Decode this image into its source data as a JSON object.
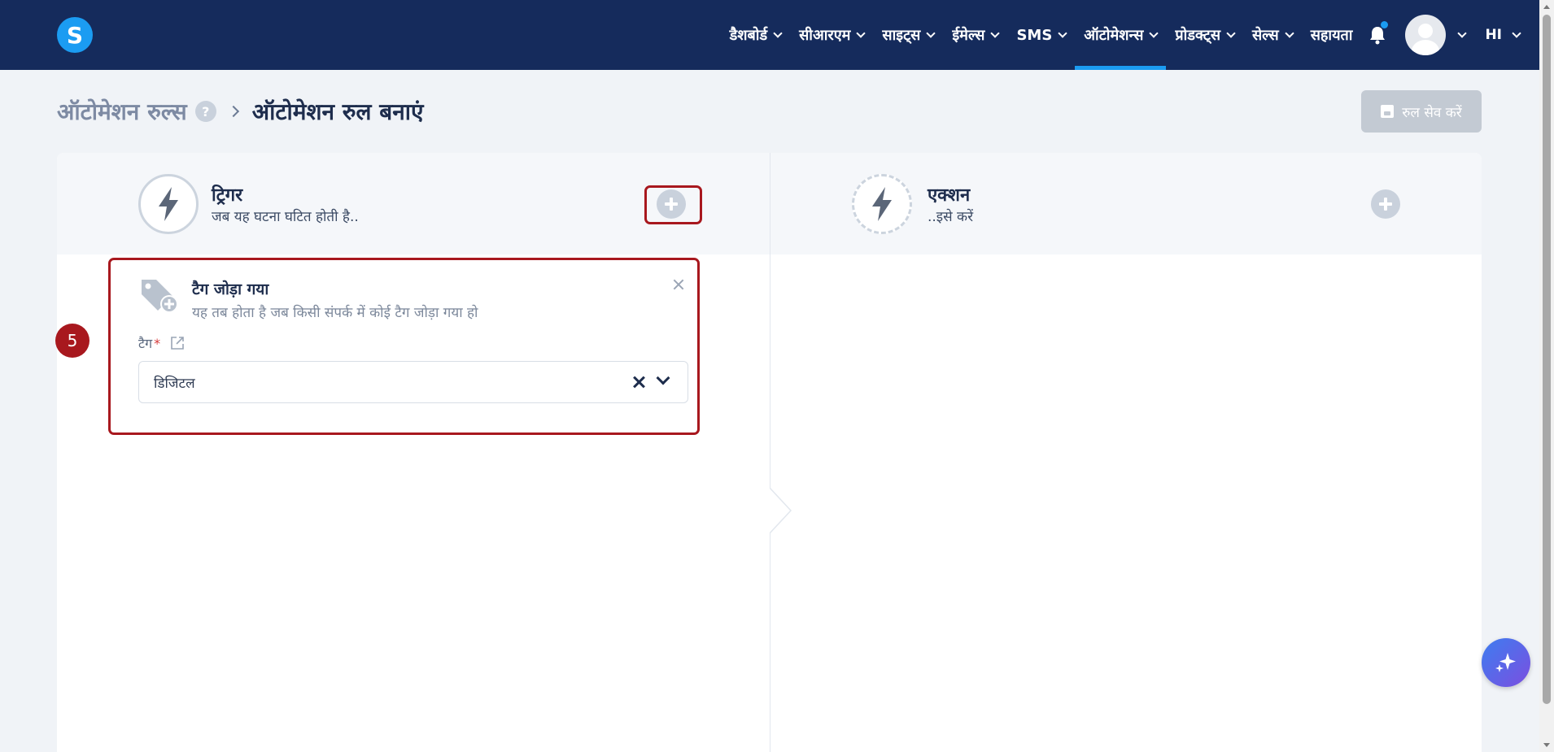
{
  "nav": {
    "items": [
      {
        "label": "डैशबोर्ड",
        "has_menu": true
      },
      {
        "label": "सीआरएम",
        "has_menu": true
      },
      {
        "label": "साइट्स",
        "has_menu": true
      },
      {
        "label": "ईमेल्स",
        "has_menu": true
      },
      {
        "label": "SMS",
        "has_menu": true
      },
      {
        "label": "ऑटोमेशन्स",
        "has_menu": true,
        "active": true
      },
      {
        "label": "प्रोडक्ट्स",
        "has_menu": true
      },
      {
        "label": "सेल्स",
        "has_menu": true
      },
      {
        "label": "सहायता",
        "has_menu": false
      }
    ],
    "language": "HI"
  },
  "logo": {
    "letter": "S"
  },
  "breadcrumb": {
    "root": "ऑटोमेशन रुल्स",
    "help": "?",
    "current": "ऑटोमेशन रुल बनाएं"
  },
  "save_button": {
    "label": "रुल सेव करें"
  },
  "trigger_panel": {
    "title": "ट्रिगर",
    "subtitle": "जब यह घटना घटित होती है.."
  },
  "action_panel": {
    "title": "एक्शन",
    "subtitle": "..इसे करें"
  },
  "trigger_card": {
    "title": "टैग जोड़ा गया",
    "description": "यह तब होता है जब किसी संपर्क में कोई टैग जोड़ा गया हो",
    "field_label": "टैग",
    "required_mark": "*",
    "selected_value": "डिजिटल"
  },
  "step_badge": "5",
  "colors": {
    "nav_bg": "#152b5c",
    "accent": "#1b9cf2",
    "highlight": "#a8181e",
    "page_bg": "#f0f3f7"
  },
  "icons": {
    "bell": "bell-icon",
    "trigger": "lightning-icon",
    "action": "lightning-cycle-icon",
    "tag": "tag-add-icon",
    "save": "floppy-disk-icon",
    "external": "external-link-icon",
    "ai": "sparkle-icon"
  }
}
